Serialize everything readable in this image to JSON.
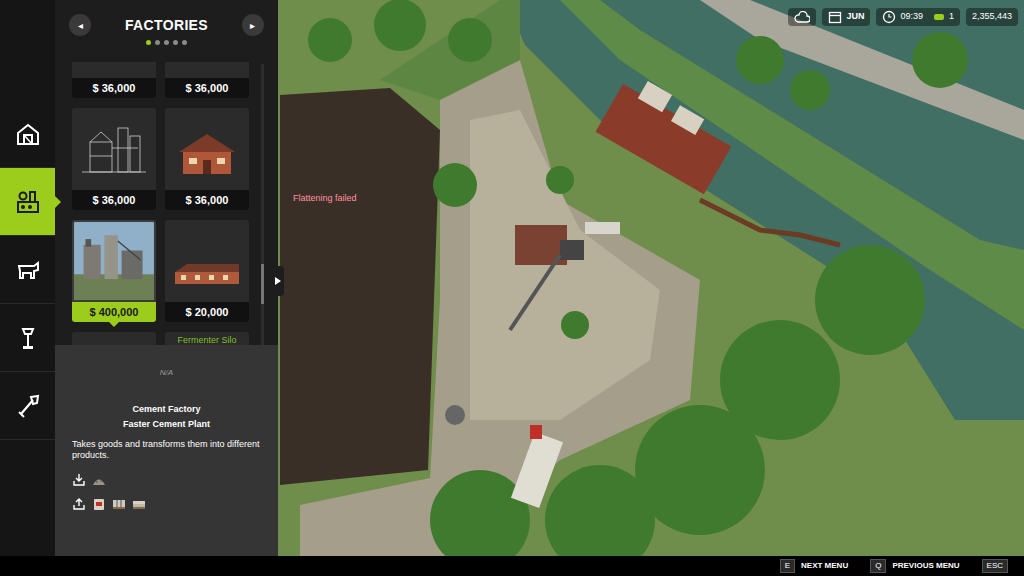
{
  "world": {
    "message": "Flattening failed"
  },
  "hud": {
    "month": "JUN",
    "time": "09:39",
    "count": "1",
    "money": "2,355,443"
  },
  "categories": [
    {
      "selected": false
    },
    {
      "selected": true
    },
    {
      "selected": false
    },
    {
      "selected": false
    },
    {
      "selected": false
    }
  ],
  "panel": {
    "title": "FACTORIES",
    "prev": "◂",
    "next": "▸",
    "pages": [
      {
        "selected": true
      },
      {
        "selected": false
      },
      {
        "selected": false
      },
      {
        "selected": false
      },
      {
        "selected": false
      }
    ]
  },
  "items": [
    {
      "price": "$ 36,000",
      "selected": false
    },
    {
      "price": "$ 36,000",
      "selected": false
    },
    {
      "price": "$ 36,000",
      "selected": false
    },
    {
      "price": "$ 36,000",
      "selected": false
    },
    {
      "price": "$ 400,000",
      "selected": true
    },
    {
      "price": "$ 20,000",
      "selected": false
    },
    {
      "selected": false
    },
    {
      "label": "Fermenter Silo",
      "selected": false
    }
  ],
  "details": {
    "status": "N/A",
    "name": "Cement Factory",
    "variant": "Faster Cement Plant",
    "description": "Takes goods and transforms them into different products."
  },
  "footer": {
    "keys": [
      {
        "key": "E",
        "label": "NEXT MENU"
      },
      {
        "key": "Q",
        "label": "PREVIOUS MENU"
      },
      {
        "key": "ESC"
      }
    ]
  }
}
